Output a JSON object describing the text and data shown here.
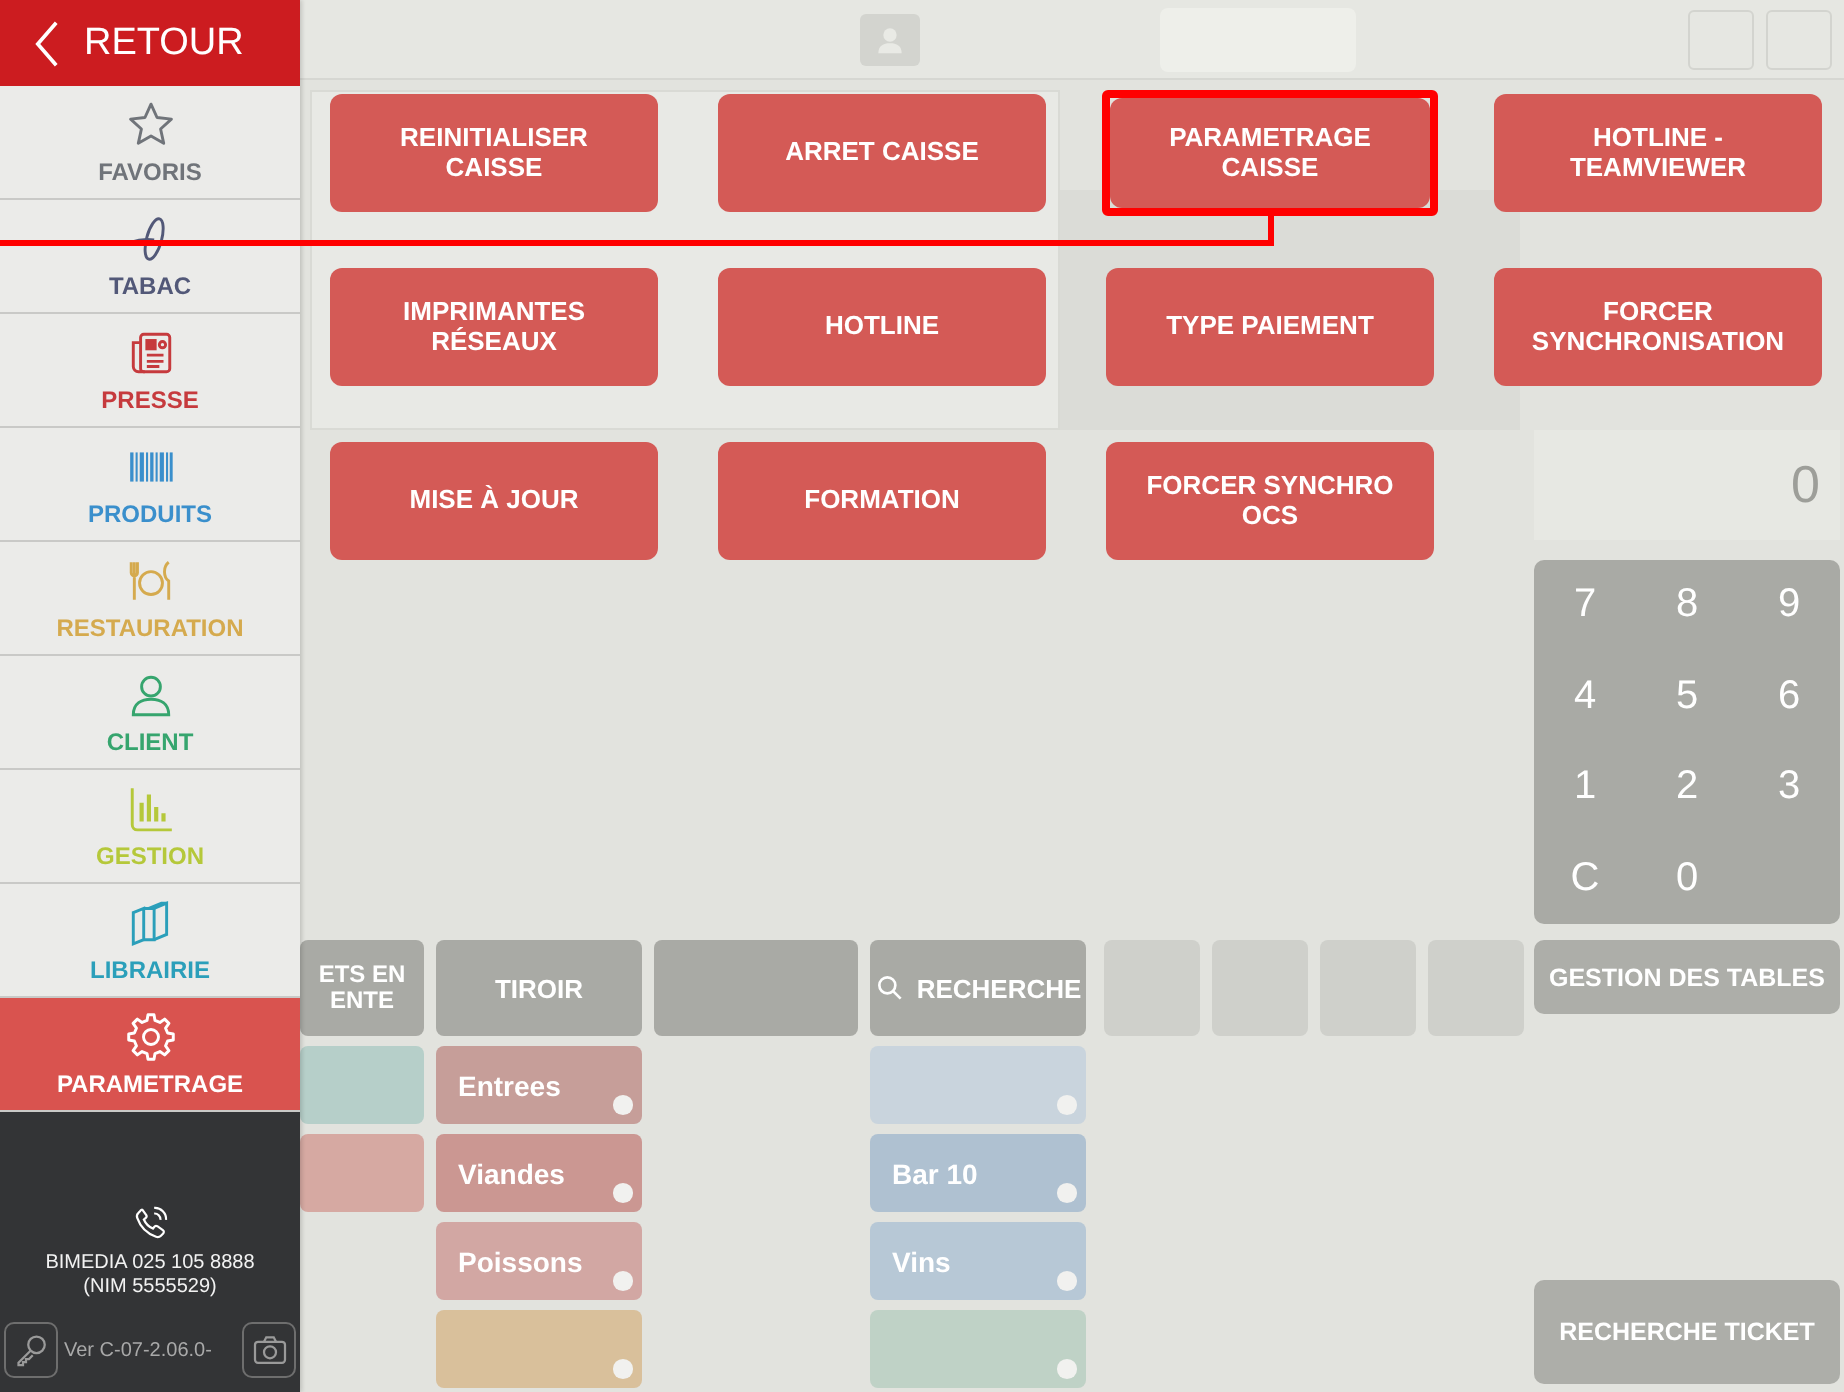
{
  "sidebar": {
    "back_button": "RETOUR",
    "items": [
      {
        "kind": "favorites",
        "label": "FAVORIS",
        "color": "#70747a",
        "selected": false
      },
      {
        "kind": "tobacco",
        "label": "TABAC",
        "color": "#525878",
        "selected": false
      },
      {
        "kind": "press",
        "label": "PRESSE",
        "color": "#c63a3d",
        "selected": false
      },
      {
        "kind": "products",
        "label": "PRODUITS",
        "color": "#3a8fcc",
        "selected": false
      },
      {
        "kind": "restaurant",
        "label": "RESTAURATION",
        "color": "#d5aa4e",
        "selected": false
      },
      {
        "kind": "client",
        "label": "CLIENT",
        "color": "#36a56e",
        "selected": false
      },
      {
        "kind": "management",
        "label": "GESTION",
        "color": "#b5c83a",
        "selected": false
      },
      {
        "kind": "library",
        "label": "LIBRAIRIE",
        "color": "#2b9fba",
        "selected": false
      },
      {
        "kind": "settings",
        "label": "PARAMETRAGE",
        "color": "#d9534f",
        "selected": true
      }
    ],
    "footer": {
      "contact": "BIMEDIA 025 105 8888",
      "nim": "(NIM 5555529)",
      "version": "Ver C-07-2.06.0-"
    }
  },
  "actions": [
    {
      "label": "REINITIALISER CAISSE",
      "highlighted": false
    },
    {
      "label": "ARRET CAISSE",
      "highlighted": false
    },
    {
      "label": "PARAMETRAGE CAISSE",
      "highlighted": true
    },
    {
      "label": "HOTLINE - TEAMVIEWER",
      "highlighted": false
    },
    {
      "label": "IMPRIMANTES RÉSEAUX",
      "highlighted": false
    },
    {
      "label": "HOTLINE",
      "highlighted": false
    },
    {
      "label": "TYPE PAIEMENT",
      "highlighted": false
    },
    {
      "label": "FORCER SYNCHRONISATION",
      "highlighted": false
    },
    {
      "label": "MISE À JOUR",
      "highlighted": false
    },
    {
      "label": "FORMATION",
      "highlighted": false
    },
    {
      "label": "FORCER SYNCHRO OCS",
      "highlighted": false
    }
  ],
  "background": {
    "toolbar": [
      "ETS EN ENTE",
      "TIROIR",
      "RECHERCHE"
    ],
    "left_tiles": [
      {
        "color": "#b6cfc9"
      },
      {
        "color": "#d6a9a2"
      }
    ],
    "categories": [
      {
        "label": "Entrees",
        "color": "#c69e99"
      },
      {
        "label": "Viandes",
        "color": "#cb9792"
      },
      {
        "label": "Poissons",
        "color": "#d2a7a3"
      },
      {
        "color": "#d9c09b"
      }
    ],
    "bar_tiles": [
      {
        "color": "#c9d4dd"
      },
      {
        "label": "Bar 10",
        "color": "#afc1d1"
      },
      {
        "label": "Vins",
        "color": "#b7c8d6"
      },
      {
        "color": "#bfd2c6"
      }
    ],
    "numpad": {
      "display": "0",
      "keys": [
        "7",
        "8",
        "9",
        "4",
        "5",
        "6",
        "1",
        "2",
        "3",
        "C",
        "0"
      ]
    },
    "tables_button": "GESTION DES TABLES",
    "ticket_search_button": "RECHERCHE TICKET"
  }
}
